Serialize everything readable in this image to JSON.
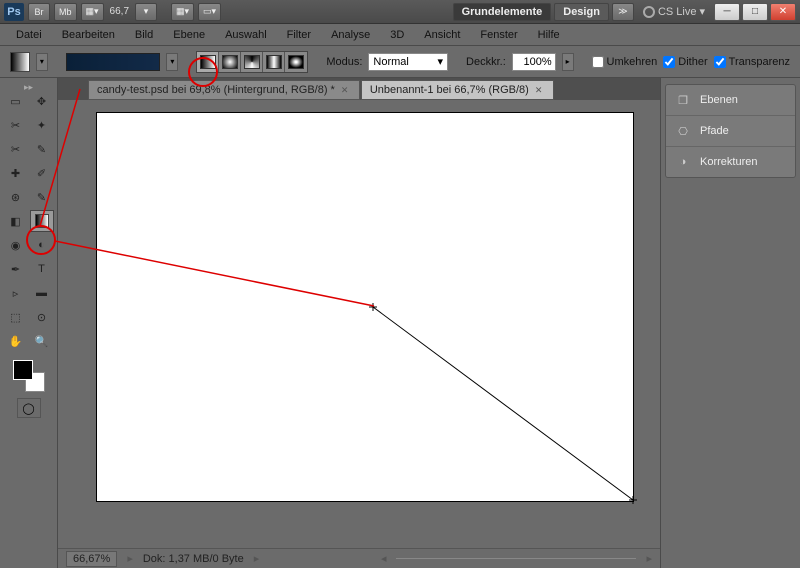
{
  "titlebar": {
    "app": "Ps",
    "zoom_value": "66,7",
    "workspace_primary": "Grundelemente",
    "workspace_secondary": "Design",
    "cslive": "CS Live",
    "br_label": "Br",
    "mb_label": "Mb"
  },
  "menu": [
    "Datei",
    "Bearbeiten",
    "Bild",
    "Ebene",
    "Auswahl",
    "Filter",
    "Analyse",
    "3D",
    "Ansicht",
    "Fenster",
    "Hilfe"
  ],
  "optbar": {
    "mode_label": "Modus:",
    "mode_value": "Normal",
    "opacity_label": "Deckkr.:",
    "opacity_value": "100%",
    "reverse": "Umkehren",
    "dither": "Dither",
    "transparency": "Transparenz"
  },
  "tabs": [
    {
      "label": "candy-test.psd bei 69,8% (Hintergrund, RGB/8) *"
    },
    {
      "label": "Unbenannt-1 bei 66,7% (RGB/8)"
    }
  ],
  "active_tab": 1,
  "statusbar": {
    "zoom": "66,67%",
    "doc": "Dok: 1,37 MB/0 Byte"
  },
  "panels": [
    "Ebenen",
    "Pfade",
    "Korrekturen"
  ],
  "chk_reverse": false,
  "chk_dither": true,
  "chk_trans": true
}
